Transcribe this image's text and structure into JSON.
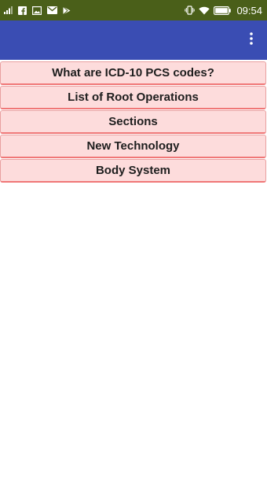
{
  "status_bar": {
    "time": "09:54",
    "background": "#4a5f19",
    "left_icons": [
      "signal-icon",
      "facebook-icon",
      "image-icon",
      "gmail-icon",
      "play-store-icon"
    ],
    "right_icons": [
      "vibrate-icon",
      "wifi-icon",
      "battery-icon"
    ]
  },
  "app_bar": {
    "background": "#3a4db3",
    "overflow_icon": "more-vertical-icon"
  },
  "menu": {
    "items": [
      {
        "label": "What are ICD-10 PCS codes?"
      },
      {
        "label": "List of Root Operations"
      },
      {
        "label": "Sections"
      },
      {
        "label": "New Technology"
      },
      {
        "label": "Body System"
      }
    ]
  },
  "colors": {
    "menu_item_bg": "#fddcdc",
    "menu_item_border": "#f07777"
  }
}
